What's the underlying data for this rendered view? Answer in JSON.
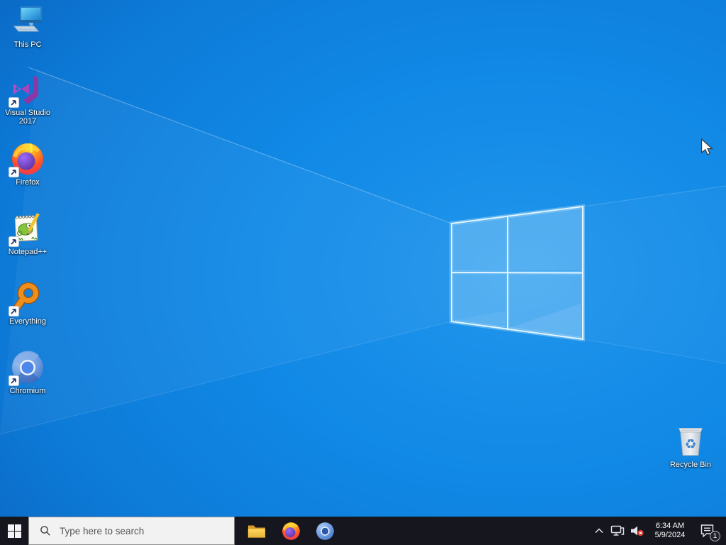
{
  "desktop": {
    "icons": [
      {
        "label": "This PC",
        "icon": "this-pc-icon"
      },
      {
        "label": "Visual Studio 2017",
        "icon": "visual-studio-2017-icon"
      },
      {
        "label": "Firefox",
        "icon": "firefox-icon"
      },
      {
        "label": "Notepad++",
        "icon": "notepadpp-icon"
      },
      {
        "label": "Everything",
        "icon": "everything-icon"
      },
      {
        "label": "Chromium",
        "icon": "chromium-icon"
      }
    ],
    "recycle_bin": {
      "label": "Recycle Bin",
      "icon": "recycle-bin-icon"
    }
  },
  "taskbar": {
    "start": {
      "icon": "windows-start-icon"
    },
    "search": {
      "placeholder": "Type here to search",
      "icon": "search-icon"
    },
    "pinned": [
      {
        "name": "file-explorer",
        "icon": "file-explorer-icon"
      },
      {
        "name": "firefox",
        "icon": "firefox-icon"
      },
      {
        "name": "chromium",
        "icon": "chromium-icon"
      }
    ],
    "tray": {
      "time": "6:34 AM",
      "date": "5/9/2024",
      "notification_count": "1",
      "icons": [
        "hidden-icons-chevron-icon",
        "network-ethernet-icon",
        "volume-muted-icon",
        "action-center-icon"
      ]
    }
  },
  "colors": {
    "wallpaper_base": "#1189e6",
    "taskbar_bg": "#16161f",
    "search_box_bg": "#f2f2f2",
    "volume_muted_badge": "#d23b30"
  }
}
